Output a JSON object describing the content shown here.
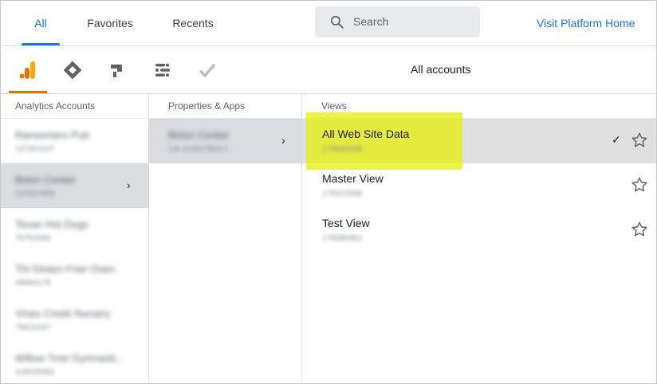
{
  "tabs": [
    {
      "label": "All",
      "active": true
    },
    {
      "label": "Favorites",
      "active": false
    },
    {
      "label": "Recents",
      "active": false
    }
  ],
  "search": {
    "placeholder": "Search",
    "icon": "search-icon"
  },
  "visit_link": "Visit Platform Home",
  "products": [
    {
      "icon": "analytics-icon",
      "color": "#e37400",
      "active": true
    },
    {
      "icon": "tag-manager-icon",
      "color": "#5f6368",
      "active": false
    },
    {
      "icon": "optimize-icon",
      "color": "#5f6368",
      "active": false
    },
    {
      "icon": "data-studio-icon",
      "color": "#5f6368",
      "active": false
    },
    {
      "icon": "surveys-icon",
      "color": "#bdbdbd",
      "active": false
    }
  ],
  "accounts_label": "All accounts",
  "columns": {
    "accounts": "Analytics Accounts",
    "properties": "Properties & Apps",
    "views": "Views"
  },
  "accounts": [
    {
      "name": "Ransomers Pub",
      "id": "127301107",
      "selected": false
    },
    {
      "name": "Belon Center",
      "id": "110207859",
      "selected": true
    },
    {
      "name": "Texas Hot Dogs",
      "id": "70752490",
      "selected": false
    },
    {
      "name": "Thi Gluten Free Oven",
      "id": "49660176",
      "selected": false
    },
    {
      "name": "Vines Creek Nursery",
      "id": "79621047",
      "selected": false
    },
    {
      "name": "Willow Tree Gymnasti...",
      "id": "118025081",
      "selected": false
    }
  ],
  "properties": [
    {
      "name": "Belon Center",
      "id": "UA-110207859-1",
      "selected": true
    }
  ],
  "views": [
    {
      "name": "All Web Site Data",
      "id": "176640098",
      "selected": true,
      "highlighted": true
    },
    {
      "name": "Master View",
      "id": "179312008",
      "selected": false,
      "highlighted": false
    },
    {
      "name": "Test View",
      "id": "179380952",
      "selected": false,
      "highlighted": false
    }
  ],
  "colors": {
    "accent": "#1a73e8",
    "analytics": "#e37400",
    "highlight": "#e6f000"
  }
}
